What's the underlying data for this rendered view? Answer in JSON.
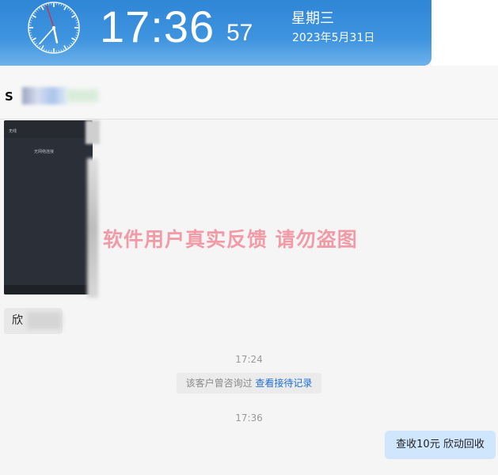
{
  "clock": {
    "time": "17:36",
    "seconds": "57",
    "weekday": "星期三",
    "date": "2023年5月31日",
    "analog": {
      "hour": 5,
      "minute": 36,
      "second": 57
    }
  },
  "chat": {
    "contact_name_prefix": "S",
    "image_caption_top": "无线",
    "image_caption_mid": "无网络连接",
    "left_bubble_text": "欣",
    "timestamps": [
      "17:24",
      "17:36"
    ],
    "notice": {
      "text": "该客户曾咨询过 ",
      "link": "查看接待记录"
    },
    "right_bubble_text": "查收10元  欣动回收"
  },
  "watermark": "软件用户真实反馈  请勿盗图",
  "colors": {
    "banner": "#3a8fdc",
    "link": "#1f6fd1",
    "right_bubble": "#cfe6fd",
    "watermark": "#f29aa6"
  }
}
